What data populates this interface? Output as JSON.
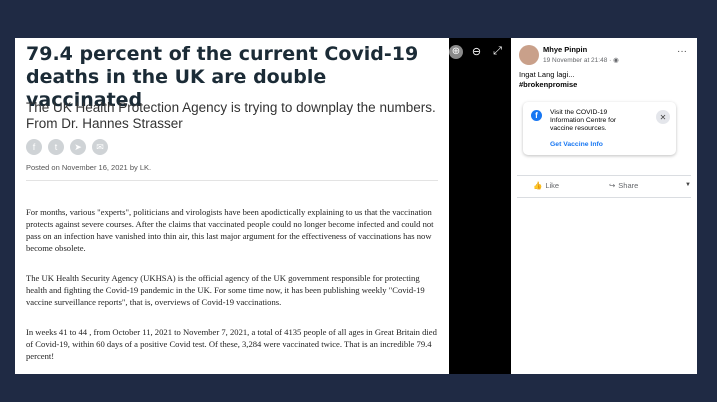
{
  "article": {
    "title": "79.4 percent of the current Covid-19 deaths in the UK are double vaccinated",
    "subtitle": "The UK Health Protection Agency is trying to downplay the numbers. From Dr. Hannes Strasser",
    "posted": "Posted on November 16, 2021 by LK.",
    "share_icons": [
      "facebook-icon",
      "twitter-icon",
      "telegram-icon",
      "email-icon"
    ],
    "p1": "For months, various \"experts\", politicians and virologists have been apodictically explaining to us that the vaccination protects against severe courses. After the claims that vaccinated people could no longer become infected and could not pass on an infection have vanished into thin air, this last major argument for the effectiveness of vaccinations has now become obsolete.",
    "p2": "The UK Health Security Agency (UKHSA) is the official agency of the UK government responsible for protecting health and fighting the Covid-19 pandemic in the UK. For some time now, it has been publishing weekly \"Covid-19 vaccine surveillance reports\", that is, overviews of Covid-19 vaccinations.",
    "p3": "In weeks 41 to 44 , from October 11, 2021 to November 7, 2021, a total of 4135 people of all ages in Great Britain died of Covid-19, within 60 days of a positive Covid test. Of these, 3,284 were vaccinated twice. That is an incredible 79.4 percent!"
  },
  "post": {
    "author": "Mhye Pinpin",
    "timestamp": "19 November at 21:48 · ◉",
    "text_line1": "Ingat Lang lagi...",
    "text_line2": "#brokenpromise",
    "more": "···"
  },
  "info_card": {
    "text": "Visit the COVID-19 Information Centre for vaccine resources.",
    "link": "Get Vaccine Info",
    "close": "✕"
  },
  "actions": {
    "like": "Like",
    "share": "Share"
  },
  "colors": {
    "accent": "#1877f2",
    "background": "#1f2a44"
  }
}
